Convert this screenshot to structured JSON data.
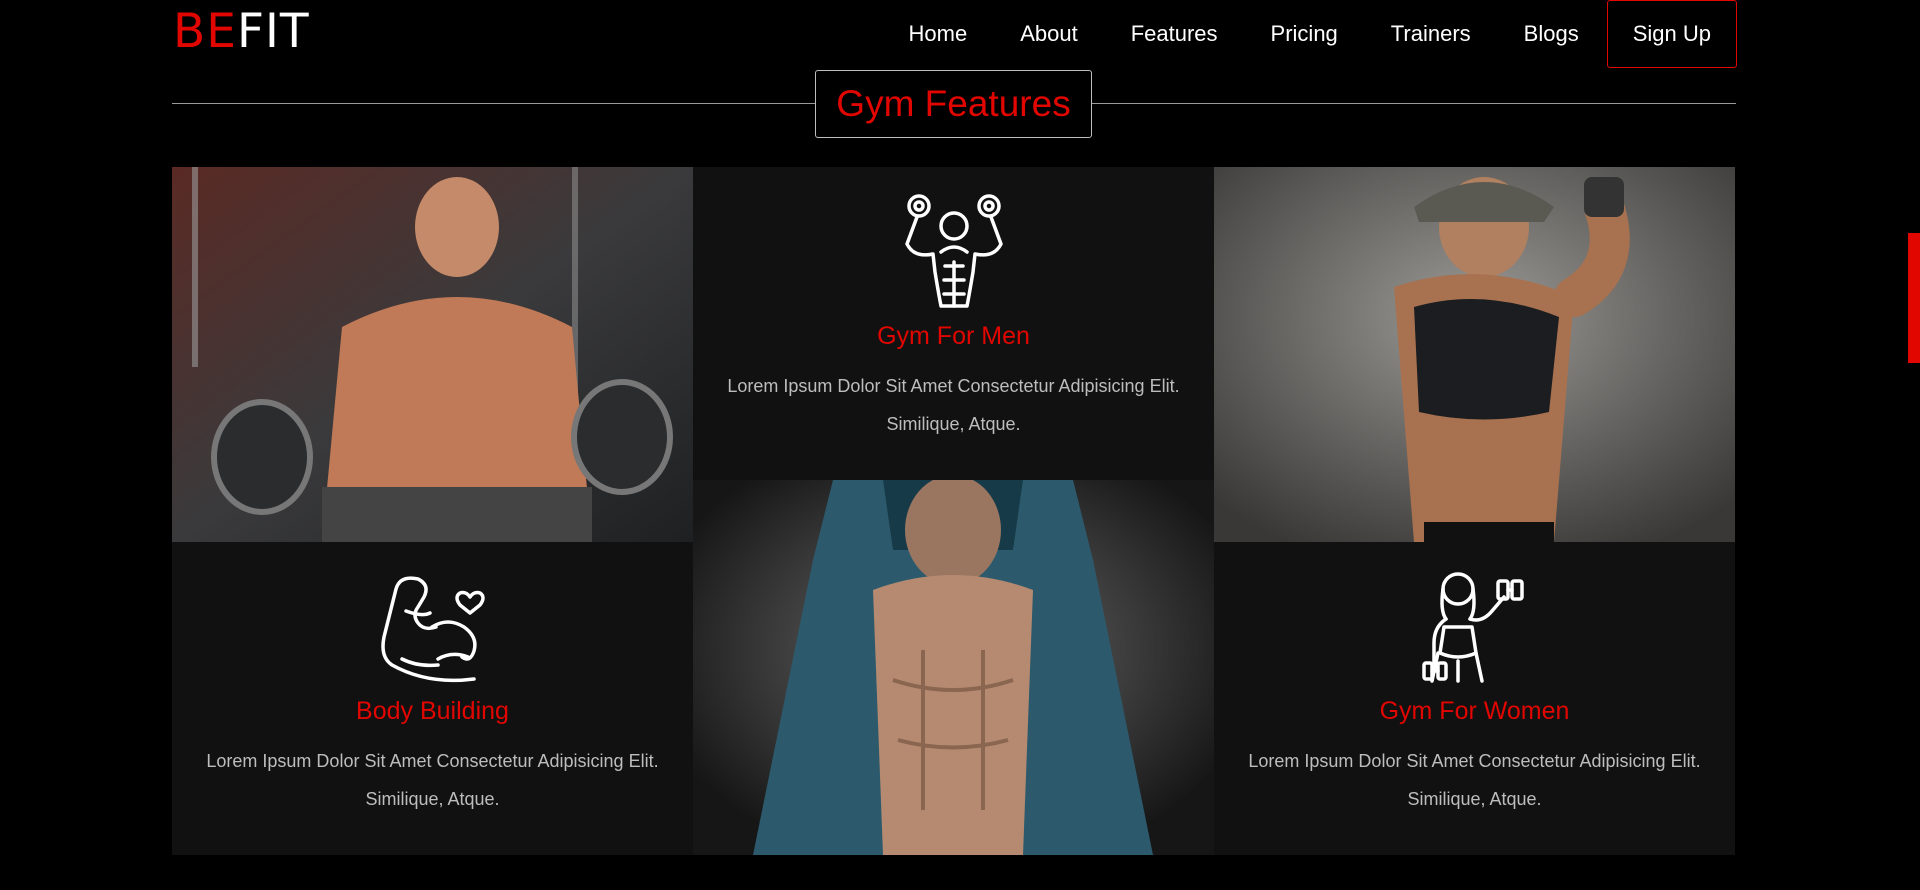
{
  "brand": {
    "part1": "BE",
    "part2": "FIT"
  },
  "nav": {
    "items": [
      "Home",
      "About",
      "Features",
      "Pricing",
      "Trainers",
      "Blogs"
    ],
    "signup": "Sign Up"
  },
  "section": {
    "title": "Gym Features"
  },
  "features": [
    {
      "title": "Gym For Men",
      "text": "Lorem Ipsum Dolor Sit Amet Consectetur Adipisicing Elit. Similique, Atque.",
      "icon": "muscle-man-icon"
    },
    {
      "title": "Body Building",
      "text": "Lorem Ipsum Dolor Sit Amet Consectetur Adipisicing Elit. Similique, Atque.",
      "icon": "flexed-arm-heart-icon"
    },
    {
      "title": "Gym For Women",
      "text": "Lorem Ipsum Dolor Sit Amet Consectetur Adipisicing Elit. Similique, Atque.",
      "icon": "woman-dumbbell-icon"
    }
  ],
  "colors": {
    "accent": "#e10600",
    "background": "#000000",
    "card": "#111111",
    "text_muted": "#bdbdbd"
  }
}
